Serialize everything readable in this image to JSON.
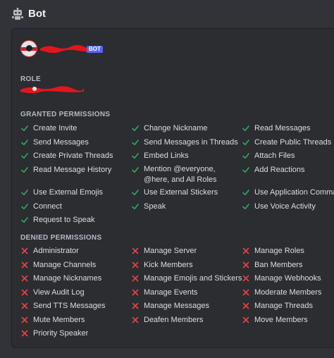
{
  "header": {
    "title": "Bot",
    "icon": "robot-icon"
  },
  "bot_tag": "BOT",
  "role_label": "ROLE",
  "granted": {
    "label": "GRANTED PERMISSIONS",
    "items": [
      "Create Invite",
      "Change Nickname",
      "Read Messages",
      "Send Messages",
      "Send Messages in Threads",
      "Create Public Threads",
      "Create Private Threads",
      "Embed Links",
      "Attach Files",
      "Read Message History",
      "Mention @everyone, @here, and All Roles",
      "Add Reactions",
      "Use External Emojis",
      "Use External Stickers",
      "Use Application Commands",
      "Connect",
      "Speak",
      "Use Voice Activity",
      "Request to Speak"
    ]
  },
  "denied": {
    "label": "DENIED PERMISSIONS",
    "items": [
      "Administrator",
      "Manage Server",
      "Manage Roles",
      "Manage Channels",
      "Kick Members",
      "Ban Members",
      "Manage Nicknames",
      "Manage Emojis and Stickers",
      "Manage Webhooks",
      "View Audit Log",
      "Manage Events",
      "Moderate Members",
      "Send TTS Messages",
      "Manage Messages",
      "Manage Threads",
      "Mute Members",
      "Deafen Members",
      "Move Members",
      "Priority Speaker"
    ]
  },
  "colors": {
    "granted_check": "#3ba55d",
    "denied_x": "#ed4245",
    "bot_tag": "#5865f2"
  }
}
